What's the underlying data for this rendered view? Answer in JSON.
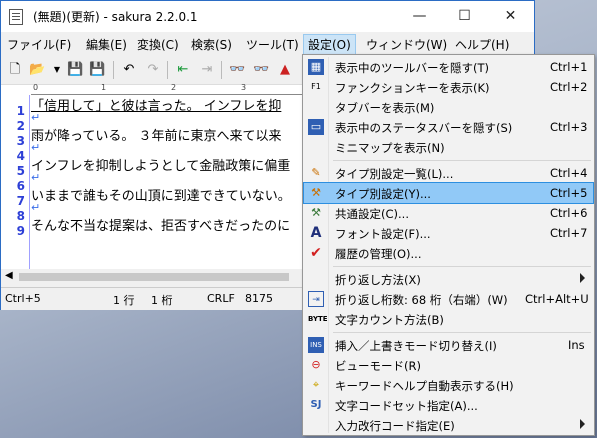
{
  "window": {
    "title": "(無題)(更新) - sakura 2.2.0.1"
  },
  "caption": {
    "minimize": "—",
    "maximize": "☐",
    "close": "✕"
  },
  "menubar": {
    "items": [
      "ファイル(F)",
      "編集(E)",
      "変換(C)",
      "検索(S)",
      "ツール(T)",
      "設定(O)",
      "ウィンドウ(W)",
      "ヘルプ(H)"
    ]
  },
  "ruler": {
    "marks": [
      "0",
      "1",
      "2",
      "3"
    ]
  },
  "editor": {
    "line_numbers": [
      "1",
      "2",
      "3",
      "4",
      "5",
      "6",
      "7",
      "8",
      "9"
    ],
    "lines": [
      "「信用して」と彼は言った。 インフレを抑",
      "",
      "雨が降っている。 ３年前に東京へ来て以来",
      "",
      "インフレを抑制しようとして金融政策に偏重",
      "",
      "いままで誰もその山頂に到達できていない。",
      "",
      "そんな不当な提案は、拒否すべきだったのに"
    ],
    "crlf_mark": "↵"
  },
  "status": {
    "cursor": "Ctrl+5",
    "row": "1 行",
    "col": "1 桁",
    "eol": "CRLF",
    "code": "8175"
  },
  "menu": {
    "items": [
      {
        "label": "表示中のツールバーを隠す(T)",
        "shortcut": "Ctrl+1",
        "icon": "toolbar-icon"
      },
      {
        "label": "ファンクションキーを表示(K)",
        "shortcut": "Ctrl+2",
        "icon": "fkey-icon"
      },
      {
        "label": "タブバーを表示(M)",
        "shortcut": "",
        "icon": ""
      },
      {
        "label": "表示中のステータスバーを隠す(S)",
        "shortcut": "Ctrl+3",
        "icon": "statusbar-icon"
      },
      {
        "label": "ミニマップを表示(N)",
        "shortcut": "",
        "icon": ""
      },
      {
        "label": "タイプ別設定一覧(L)...",
        "shortcut": "Ctrl+4",
        "icon": "type-list-icon"
      },
      {
        "label": "タイプ別設定(Y)...",
        "shortcut": "Ctrl+5",
        "icon": "type-setting-icon"
      },
      {
        "label": "共通設定(C)...",
        "shortcut": "Ctrl+6",
        "icon": "common-setting-icon"
      },
      {
        "label": "フォント設定(F)...",
        "shortcut": "Ctrl+7",
        "icon": "font-icon"
      },
      {
        "label": "履歴の管理(O)...",
        "shortcut": "",
        "icon": "checkmark-icon"
      },
      {
        "label": "折り返し方法(X)",
        "shortcut": "",
        "icon": ""
      },
      {
        "label": "折り返し桁数: 68 桁（右端）(W)",
        "shortcut": "Ctrl+Alt+U",
        "icon": "wrap-icon"
      },
      {
        "label": "文字カウント方法(B)",
        "shortcut": "",
        "icon": "byte-icon"
      },
      {
        "label": "挿入／上書きモード切り替え(I)",
        "shortcut": "Ins",
        "icon": "insert-icon"
      },
      {
        "label": "ビューモード(R)",
        "shortcut": "",
        "icon": "viewmode-icon"
      },
      {
        "label": "キーワードヘルプ自動表示する(H)",
        "shortcut": "",
        "icon": "keyword-help-icon"
      },
      {
        "label": "文字コードセット指定(A)...",
        "shortcut": "",
        "icon": "charset-icon"
      },
      {
        "label": "入力改行コード指定(E)",
        "shortcut": "",
        "icon": ""
      }
    ]
  },
  "colors": {
    "highlight": "#91c9f7",
    "line_numbers": "#2d3fd6",
    "crlf": "#3a6ee8"
  }
}
